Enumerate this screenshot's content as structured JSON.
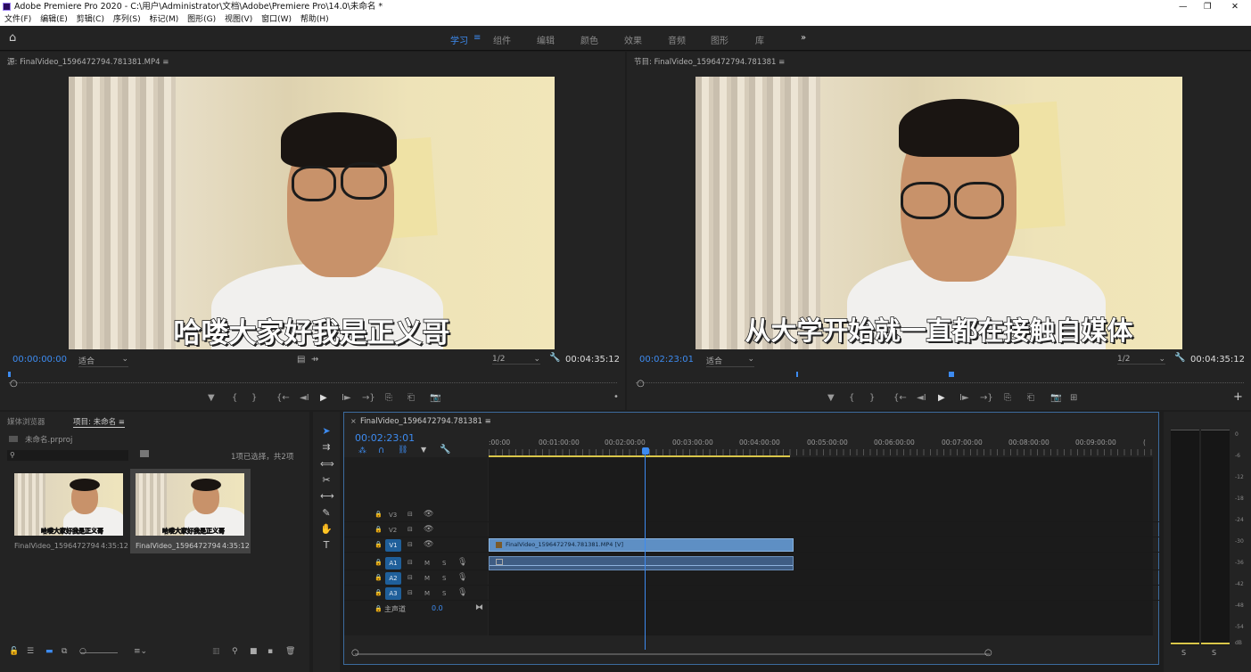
{
  "titlebar": {
    "app_title": "Adobe Premiere Pro 2020 - C:\\用户\\Administrator\\文档\\Adobe\\Premiere Pro\\14.0\\未命名 *",
    "min": "—",
    "restore": "❐",
    "close": "✕"
  },
  "menu": [
    "文件(F)",
    "编辑(E)",
    "剪辑(C)",
    "序列(S)",
    "标记(M)",
    "图形(G)",
    "视图(V)",
    "窗口(W)",
    "帮助(H)"
  ],
  "workspaces": {
    "items": [
      "学习",
      "组件",
      "编辑",
      "颜色",
      "效果",
      "音频",
      "图形",
      "库"
    ],
    "active": "学习",
    "more": "»",
    "menu_icon": "≡"
  },
  "source": {
    "title": "源: FinalVideo_1596472794.781381.MP4 ≡",
    "timecode": "00:00:00:00",
    "fit": "适合",
    "resolution": "1/2",
    "duration": "00:04:35:12",
    "subtitle": "哈喽大家好我是正义哥"
  },
  "program": {
    "title": "节目: FinalVideo_1596472794.781381 ≡",
    "timecode": "00:02:23:01",
    "fit": "适合",
    "resolution": "1/2",
    "duration": "00:04:35:12",
    "subtitle": "从大学开始就一直都在接触自媒体"
  },
  "transport": {
    "marker": "▼",
    "in": "{",
    "out": "}",
    "goto_in": "{←",
    "step_back": "◄I",
    "play": "▶",
    "step_fwd": "I►",
    "goto_out": "→}",
    "lift": "⎘",
    "extract": "⎗",
    "camera": "📷",
    "compare": "⊞",
    "plus": "+"
  },
  "project": {
    "tab_media_browser": "媒体浏览器",
    "tab_project": "项目: 未命名",
    "project_file": "未命名.prproj",
    "selection_status": "1项已选择，共2项",
    "search_placeholder": "",
    "clips": [
      {
        "name": "FinalVideo_1596472794.7...",
        "duration": "4:35:12",
        "caption": "哈喽大家好我是正义哥"
      },
      {
        "name": "FinalVideo_1596472794.7...",
        "duration": "4:35:12",
        "caption": "哈喽大家好我是正义哥"
      }
    ]
  },
  "timeline": {
    "sequence_tab": "FinalVideo_1596472794.781381 ≡",
    "close_tab": "×",
    "timecode": "00:02:23:01",
    "ruler": [
      ":00:00",
      "00:01:00:00",
      "00:02:00:00",
      "00:03:00:00",
      "00:04:00:00",
      "00:05:00:00",
      "00:06:00:00",
      "00:07:00:00",
      "00:08:00:00",
      "00:09:00:00",
      "("
    ],
    "video_tracks": [
      {
        "label": "V3"
      },
      {
        "label": "V2"
      },
      {
        "label": "V1"
      }
    ],
    "audio_tracks": [
      {
        "label": "A1"
      },
      {
        "label": "A2"
      },
      {
        "label": "A3"
      }
    ],
    "master_label": "主声道",
    "master_value": "0.0",
    "clip_label": "FinalVideo_1596472794.781381.MP4 [V]",
    "mute": "M",
    "solo": "S"
  },
  "meter": {
    "scale": [
      "0",
      "-6",
      "-12",
      "-18",
      "-24",
      "-30",
      "-36",
      "-42",
      "-48",
      "-54",
      "dB"
    ],
    "solo_left": "S",
    "solo_right": "S"
  },
  "colors": {
    "accent": "#3d8bf0",
    "clip": "#5e8fc4",
    "track_label": "#1f5f9a",
    "playhead": "#3d8bf0"
  }
}
